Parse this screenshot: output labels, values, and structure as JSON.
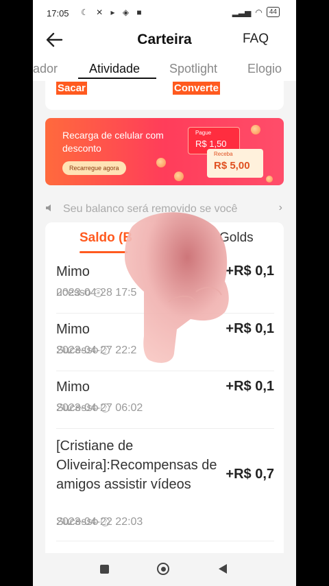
{
  "status_bar": {
    "time": "17:05",
    "battery": "44"
  },
  "header": {
    "title": "Carteira",
    "faq": "FAQ"
  },
  "tabs": [
    {
      "label": "iador"
    },
    {
      "label": "Atividade",
      "active": true
    },
    {
      "label": "Spotlight"
    },
    {
      "label": "Elogio"
    }
  ],
  "top_card": {
    "sacar": "Sacar",
    "converte": "Converte"
  },
  "banner": {
    "text": "Recarga de celular com desconto",
    "button": "Recarregue agora",
    "pague_label": "Pague",
    "pague_amount": "R$ 1,50",
    "receba_label": "Receba",
    "receba_amount": "R$ 5,00"
  },
  "notice": {
    "text": "Seu balanco será removido se você"
  },
  "card_tabs": {
    "saldo": "Saldo (B",
    "golds": "Golds"
  },
  "transactions": [
    {
      "name": "Mimo",
      "amount": "+R$ 0,1",
      "date": "2023-04-28 17:5",
      "status": "ucesso"
    },
    {
      "name": "Mimo",
      "amount": "+R$ 0,1",
      "date": "2023-04-27 22:2",
      "status": "Sucesso"
    },
    {
      "name": "Mimo",
      "amount": "+R$ 0,1",
      "date": "2023-04-27 06:02",
      "status": "Sucesso"
    },
    {
      "name": "[Cristiane de Oliveira]:Recompensas de amigos assistir vídeos",
      "amount": "+R$ 0,7",
      "date": "2023-04-22 22:03",
      "status": "Sucesso"
    }
  ],
  "colors": {
    "accent": "#ff5a1f",
    "banner_start": "#ff6a3d",
    "banner_end": "#ff3d5a"
  }
}
